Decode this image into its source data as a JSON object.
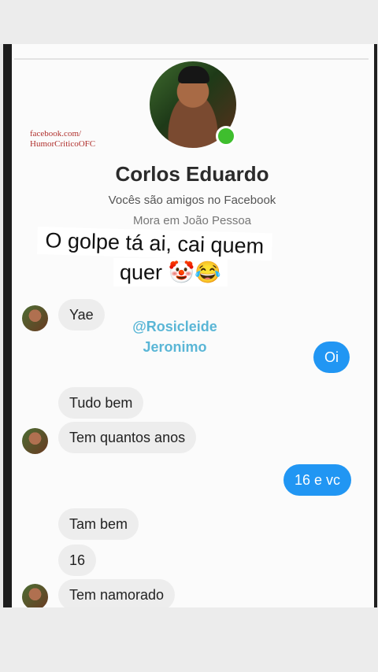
{
  "profile": {
    "name": "Corlos Eduardo",
    "friends_note": "Vocês são amigos no Facebook",
    "lives_note": "Mora em João Pessoa"
  },
  "watermark": {
    "line1": "facebook.com/",
    "line2": "HumorCriticoOFC"
  },
  "caption": {
    "line1": "O golpe tá ai, cai quem",
    "line2": "quer 🤡😂"
  },
  "credit": {
    "line1": "@Rosicleide",
    "line2": "Jeronimo"
  },
  "messages": [
    {
      "from": "them",
      "text": "Yae"
    },
    {
      "from": "me",
      "text": "Oi"
    },
    {
      "from": "them",
      "text": "Tudo bem"
    },
    {
      "from": "them",
      "text": "Tem quantos anos"
    },
    {
      "from": "me",
      "text": "16 e vc"
    },
    {
      "from": "them",
      "text": "Tam bem"
    },
    {
      "from": "them",
      "text": "16"
    },
    {
      "from": "them",
      "text": "Tem namorado"
    }
  ],
  "colors": {
    "outgoing_bubble": "#2196f3",
    "incoming_bubble": "#ededed",
    "online_indicator": "#3fbe2e",
    "credit_text": "#5ab6d6"
  }
}
